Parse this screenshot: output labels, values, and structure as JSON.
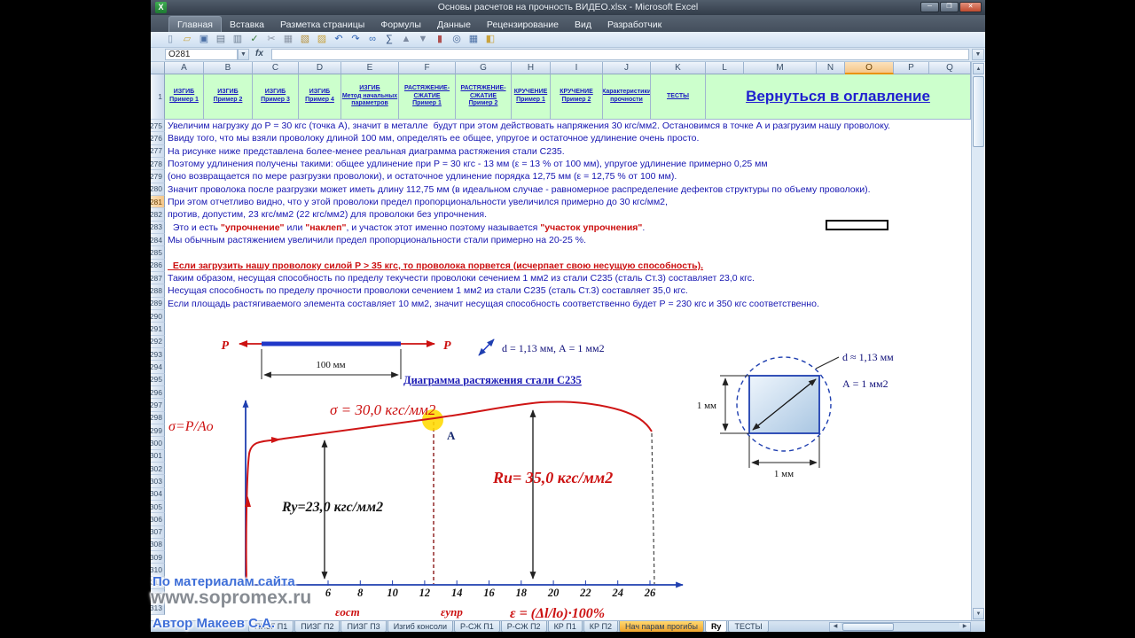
{
  "window": {
    "title": "Основы расчетов на прочность ВИДЕО.xlsx - Microsoft Excel"
  },
  "ribbon": {
    "tabs": [
      "Главная",
      "Вставка",
      "Разметка страницы",
      "Формулы",
      "Данные",
      "Рецензирование",
      "Вид",
      "Разработчик"
    ],
    "active_tab": "Главная"
  },
  "toolbar": {
    "icons": [
      {
        "name": "new-document-icon",
        "glyph": "▯",
        "color": "#7c92ad"
      },
      {
        "name": "open-icon",
        "glyph": "▱",
        "color": "#c9a23c"
      },
      {
        "name": "save-icon",
        "glyph": "▣",
        "color": "#4a6fa5"
      },
      {
        "name": "print-icon",
        "glyph": "▤",
        "color": "#68798e"
      },
      {
        "name": "print-preview-icon",
        "glyph": "▥",
        "color": "#68798e"
      },
      {
        "name": "spell-check-icon",
        "glyph": "✓",
        "color": "#3a7a3a"
      },
      {
        "name": "cut-icon",
        "glyph": "✂",
        "color": "#8a94a4"
      },
      {
        "name": "copy-icon",
        "glyph": "▦",
        "color": "#8a94a4"
      },
      {
        "name": "paste-icon",
        "glyph": "▧",
        "color": "#b8923e"
      },
      {
        "name": "format-painter-icon",
        "glyph": "▨",
        "color": "#c9a23c"
      },
      {
        "name": "undo-icon",
        "glyph": "↶",
        "color": "#2f62b3"
      },
      {
        "name": "redo-icon",
        "glyph": "↷",
        "color": "#2f62b3"
      },
      {
        "name": "insert-hyperlink-icon",
        "glyph": "∞",
        "color": "#3a6fb8"
      },
      {
        "name": "autosum-icon",
        "glyph": "∑",
        "color": "#2c4a78"
      },
      {
        "name": "sort-asc-icon",
        "glyph": "▲",
        "color": "#7c8aa0"
      },
      {
        "name": "sort-desc-icon",
        "glyph": "▼",
        "color": "#7c8aa0"
      },
      {
        "name": "chart-wizard-icon",
        "glyph": "▮",
        "color": "#b05050"
      },
      {
        "name": "zoom-icon",
        "glyph": "◎",
        "color": "#4a6a9a"
      },
      {
        "name": "borders-icon",
        "glyph": "▦",
        "color": "#4a6fa5"
      },
      {
        "name": "fill-color-icon",
        "glyph": "◧",
        "color": "#c9a23c"
      }
    ]
  },
  "formula_bar": {
    "name_box": "O281"
  },
  "grid": {
    "columns": [
      "A",
      "B",
      "C",
      "D",
      "E",
      "F",
      "G",
      "H",
      "I",
      "J",
      "K",
      "L",
      "M",
      "N",
      "O",
      "P",
      "Q"
    ],
    "selected_column": "O",
    "selected_row": "281",
    "nav_row_num": "1",
    "nav_links": [
      {
        "lines": [
          "ИЗГИБ",
          "Пример 1"
        ]
      },
      {
        "lines": [
          "ИЗГИБ",
          "Пример 2"
        ]
      },
      {
        "lines": [
          "ИЗГИБ",
          "Пример 3"
        ]
      },
      {
        "lines": [
          "ИЗГИБ",
          "Пример 4"
        ]
      },
      {
        "lines": [
          "ИЗГИБ",
          "Метод начальных",
          "параметров"
        ]
      },
      {
        "lines": [
          "РАСТЯЖЕНИЕ-",
          "СЖАТИЕ",
          "Пример 1"
        ]
      },
      {
        "lines": [
          "РАСТЯЖЕНИЕ-",
          "СЖАТИЕ",
          "Пример 2"
        ]
      },
      {
        "lines": [
          "КРУЧЕНИЕ",
          "Пример 1"
        ]
      },
      {
        "lines": [
          "КРУЧЕНИЕ",
          "Пример 2"
        ]
      },
      {
        "lines": [
          "Характеристики",
          "прочности"
        ]
      },
      {
        "lines": [
          "ТЕСТЫ"
        ]
      }
    ],
    "back_link": "Вернуться в оглавление",
    "rows": [
      {
        "num": "275",
        "segments": [
          {
            "cls": "b",
            "text": "Увеличим нагрузку до Р = 30 кгс (точка А), значит в металле  будут при этом действовать напряжения 30 кгс/мм2. Остановимся в точке А и разгрузим нашу проволоку."
          }
        ]
      },
      {
        "num": "276",
        "segments": [
          {
            "cls": "b",
            "text": "Ввиду того, что мы взяли проволоку длиной 100 мм, определять ее общее, упругое и остаточное удлинение очень просто."
          }
        ]
      },
      {
        "num": "277",
        "segments": [
          {
            "cls": "b",
            "text": "На рисунке ниже представлена более-менее реальная диаграмма растяжения стали С235."
          }
        ]
      },
      {
        "num": "278",
        "segments": [
          {
            "cls": "b",
            "text": "Поэтому удлинения получены такими: общее удлинение при Р = 30 кгс - 13 мм (ε = 13 % от 100 мм), упругое удлинение примерно 0,25 мм"
          }
        ]
      },
      {
        "num": "279",
        "segments": [
          {
            "cls": "b",
            "text": "(оно возвращается по мере разгрузки проволоки), и остаточное удлинение порядка 12,75 мм (ε = 12,75 % от 100 мм)."
          }
        ]
      },
      {
        "num": "280",
        "segments": [
          {
            "cls": "b",
            "text": "Значит проволока после разгрузки может иметь длину 112,75 мм (в идеальном случае - равномерное распределение дефектов структуры по объему проволоки)."
          }
        ]
      },
      {
        "num": "281",
        "segments": [
          {
            "cls": "b",
            "text": "При этом отчетливо видно, что у этой проволоки предел пропорциональности увеличился примерно до 30 кгс/мм2,"
          }
        ]
      },
      {
        "num": "282",
        "segments": [
          {
            "cls": "b",
            "text": "против, допустим, 23 кгс/мм2 (22 кгс/мм2) для проволоки без упрочнения."
          }
        ]
      },
      {
        "num": "283",
        "segments": [
          {
            "cls": "b",
            "text": "  Это и есть "
          },
          {
            "cls": "r",
            "text": "\"упрочнение\""
          },
          {
            "cls": "b",
            "text": " или "
          },
          {
            "cls": "r",
            "text": "\"наклеп\""
          },
          {
            "cls": "b",
            "text": ", и участок этот именно поэтому называется "
          },
          {
            "cls": "r",
            "text": "\"участок упрочнения\""
          },
          {
            "cls": "b",
            "text": "."
          }
        ]
      },
      {
        "num": "284",
        "segments": [
          {
            "cls": "b",
            "text": "Мы обычным растяжением увеличили предел пропорциональности стали примерно на 20-25 %."
          }
        ]
      },
      {
        "num": "285",
        "segments": []
      },
      {
        "num": "286",
        "segments": [
          {
            "cls": "ru",
            "text": "  Если загрузить нашу проволоку силой Р > 35 кгс, то проволока порвется (исчерпает свою несущую способность)."
          }
        ]
      },
      {
        "num": "287",
        "segments": [
          {
            "cls": "b",
            "text": "Таким образом, несущая способность по пределу текучести проволоки сечением 1 мм2 из стали С235 (сталь Ст.3) составляет 23,0 кгс."
          }
        ]
      },
      {
        "num": "288",
        "segments": [
          {
            "cls": "b",
            "text": "Несущая способность по пределу прочности проволоки сечением 1 мм2 из стали С235 (сталь Ст.3) составляет 35,0 кгс."
          }
        ]
      },
      {
        "num": "289",
        "segments": [
          {
            "cls": "b",
            "text": "Если площадь растягиваемого элемента составляет 10 мм2, значит несущая способность соответственно будет Р = 230 кгс и 350 кгс соответственно."
          }
        ]
      }
    ],
    "chart_row_numbers": [
      "290",
      "291",
      "292",
      "293",
      "294",
      "295",
      "296",
      "297",
      "298",
      "299",
      "300",
      "301",
      "302",
      "303",
      "304",
      "305",
      "306",
      "307",
      "308",
      "309",
      "310",
      "311",
      "312",
      "313"
    ]
  },
  "chart": {
    "force_label_left": "P",
    "force_label_right": "P",
    "wire_length_label": "100 мм",
    "wire_spec": "d = 1,13 мм,  А = 1 мм2",
    "title": "Диаграмма растяжения стали С235",
    "y_axis_label": "σ=P/Aо",
    "sigma_label": "σ = 30,0 кгс/мм2",
    "point_label": "А",
    "ry_label": "Ry=23,0 кгс/мм2",
    "ru_label": "Ru= 35,0 кгс/мм2",
    "x_ticks": [
      "6",
      "8",
      "10",
      "12",
      "14",
      "16",
      "18",
      "20",
      "22",
      "24",
      "26"
    ],
    "eps_ost": "εост",
    "eps_upr": "εупр",
    "eps_formula": "ε = (Δl/lо)·100%"
  },
  "section": {
    "d_label": "d ≈ 1,13 мм",
    "area_label": "А = 1 мм2",
    "side_label_left": "1 мм",
    "side_label_bottom": "1 мм"
  },
  "sheet_tabs": {
    "tabs": [
      {
        "label": "ПИЗГ П1",
        "state": "normal"
      },
      {
        "label": "ПИЗГ П2",
        "state": "normal"
      },
      {
        "label": "ПИЗГ П3",
        "state": "normal"
      },
      {
        "label": "Изгиб консоли",
        "state": "normal"
      },
      {
        "label": "Р-СЖ П1",
        "state": "normal"
      },
      {
        "label": "Р-СЖ П2",
        "state": "normal"
      },
      {
        "label": "КР П1",
        "state": "normal"
      },
      {
        "label": "КР П2",
        "state": "normal"
      },
      {
        "label": "Нач парам прогибы",
        "state": "highlighted"
      },
      {
        "label": "Ry",
        "state": "active"
      },
      {
        "label": "ТЕСТЫ",
        "state": "normal"
      }
    ]
  },
  "watermark": {
    "line1": "По материалам сайта",
    "line2": "www.sopromex.ru",
    "line3": "Автор Макеев С.А."
  },
  "colors": {
    "nav_bg": "#ccffcc",
    "link_blue": "#1a1ac0",
    "body_text_blue": "#1717b2",
    "alert_red": "#cc1111",
    "selection_highlight": "#f5c689",
    "curve_red": "#cf1515",
    "axis_blue": "#1f3fb0",
    "point_highlight_yellow": "#ffd900"
  }
}
